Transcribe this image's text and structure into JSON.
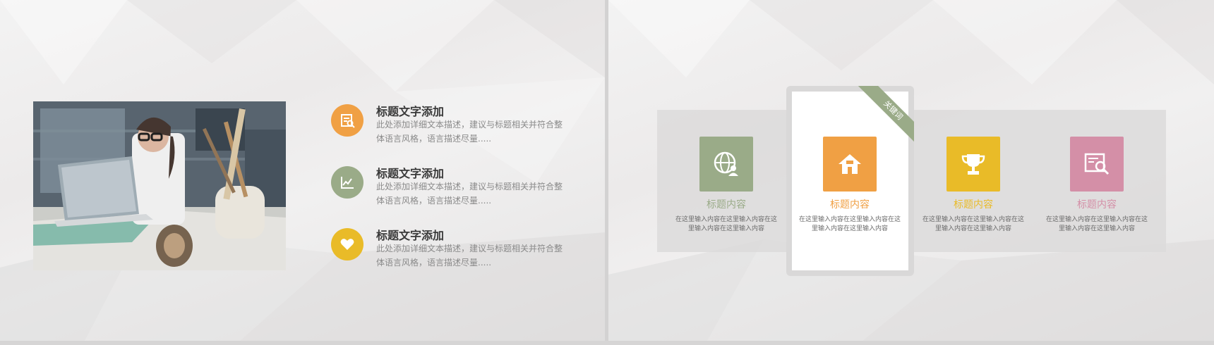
{
  "left_slide": {
    "items": [
      {
        "title": "标题文字添加",
        "desc": "此处添加详细文本描述，建议与标题相关并符合整体语言风格，语言描述尽量.....",
        "icon": "document-search-icon",
        "color": "#f0a044"
      },
      {
        "title": "标题文字添加",
        "desc": "此处添加详细文本描述，建议与标题相关并符合整体语言风格，语言描述尽量.....",
        "icon": "line-chart-icon",
        "color": "#9aab88"
      },
      {
        "title": "标题文字添加",
        "desc": "此处添加详细文本描述，建议与标题相关并符合整体语言风格，语言描述尽量.....",
        "icon": "heart-icon",
        "color": "#e9bb28"
      }
    ]
  },
  "right_slide": {
    "ribbon_label": "关键词",
    "columns": [
      {
        "title": "标题内容",
        "text": "在这里输入内容在这里输入内容在这里输入内容在这里输入内容",
        "icon": "globe-user-icon",
        "color": "#9aab88"
      },
      {
        "title": "标题内容",
        "text": "在这里输入内容在这里输入内容在这里输入内容在这里输入内容",
        "icon": "home-icon",
        "color": "#f0a044"
      },
      {
        "title": "标题内容",
        "text": "在这里输入内容在这里输入内容在这里输入内容在这里输入内容",
        "icon": "trophy-icon",
        "color": "#e9bb28"
      },
      {
        "title": "标题内容",
        "text": "在这里输入内容在这里输入内容在这里输入内容在这里输入内容",
        "icon": "search-document-icon",
        "color": "#d48fa7"
      }
    ]
  }
}
